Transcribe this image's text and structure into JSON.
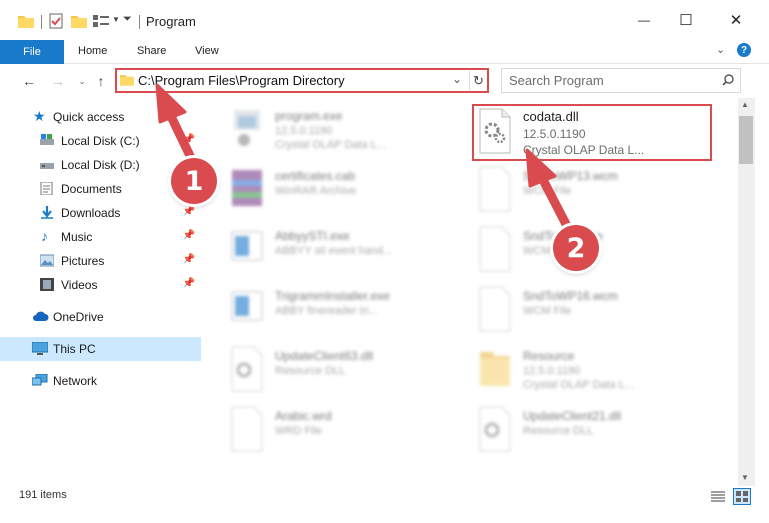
{
  "window": {
    "title": "Program",
    "minimize_glyph": "—",
    "maximize_glyph": "☐",
    "close_glyph": "✕"
  },
  "ribbon": {
    "tabs": [
      "File",
      "Home",
      "Share",
      "View"
    ]
  },
  "address": {
    "path": "C:\\Program Files\\Program Directory",
    "search_placeholder": "Search Program"
  },
  "sidebar": {
    "items": [
      {
        "label": "Quick access",
        "icon": "star-icon"
      },
      {
        "label": "Local Disk (C:)",
        "icon": "drive-icon"
      },
      {
        "label": "Local Disk (D:)",
        "icon": "drive-icon"
      },
      {
        "label": "Documents",
        "icon": "documents-icon"
      },
      {
        "label": "Downloads",
        "icon": "download-icon"
      },
      {
        "label": "Music",
        "icon": "music-icon"
      },
      {
        "label": "Pictures",
        "icon": "pictures-icon"
      },
      {
        "label": "Videos",
        "icon": "videos-icon"
      },
      {
        "label": "OneDrive",
        "icon": "cloud-icon"
      },
      {
        "label": "This PC",
        "icon": "computer-icon"
      },
      {
        "label": "Network",
        "icon": "network-icon"
      }
    ]
  },
  "files": [
    {
      "name": "program.exe",
      "line1": "12.5.0.1190",
      "line2": "Crystal OLAP Data L..."
    },
    {
      "name": "codata.dll",
      "line1": "12.5.0.1190",
      "line2": "Crystal OLAP Data L..."
    },
    {
      "name": "certificates.cab",
      "line1": "WinRAR Archive",
      "line2": ""
    },
    {
      "name": "SndToWP13.wcm",
      "line1": "WCM File",
      "line2": ""
    },
    {
      "name": "AbbyySTI.exe",
      "line1": "ABBYY sti event hand...",
      "line2": ""
    },
    {
      "name": "SndToWP.wcm",
      "line1": "WCM File",
      "line2": ""
    },
    {
      "name": "TrigrammInstaller.exe",
      "line1": "ABBY finereader tri...",
      "line2": ""
    },
    {
      "name": "SndToWP16.wcm",
      "line1": "WCM File",
      "line2": ""
    },
    {
      "name": "UpdateClient63.dll",
      "line1": "Resource DLL",
      "line2": ""
    },
    {
      "name": "Resource",
      "line1": "12.5.0.1190",
      "line2": "Crystal OLAP Data L..."
    },
    {
      "name": "Arabic.wrd",
      "line1": "WRD File",
      "line2": ""
    },
    {
      "name": "UpdateClient21.dll",
      "line1": "Resource DLL",
      "line2": ""
    }
  ],
  "status": {
    "count": "191 items"
  },
  "callouts": [
    "1",
    "2"
  ],
  "colors": {
    "accent": "#1979ca",
    "highlight": "#d94b4f",
    "selected": "#cce8ff"
  }
}
